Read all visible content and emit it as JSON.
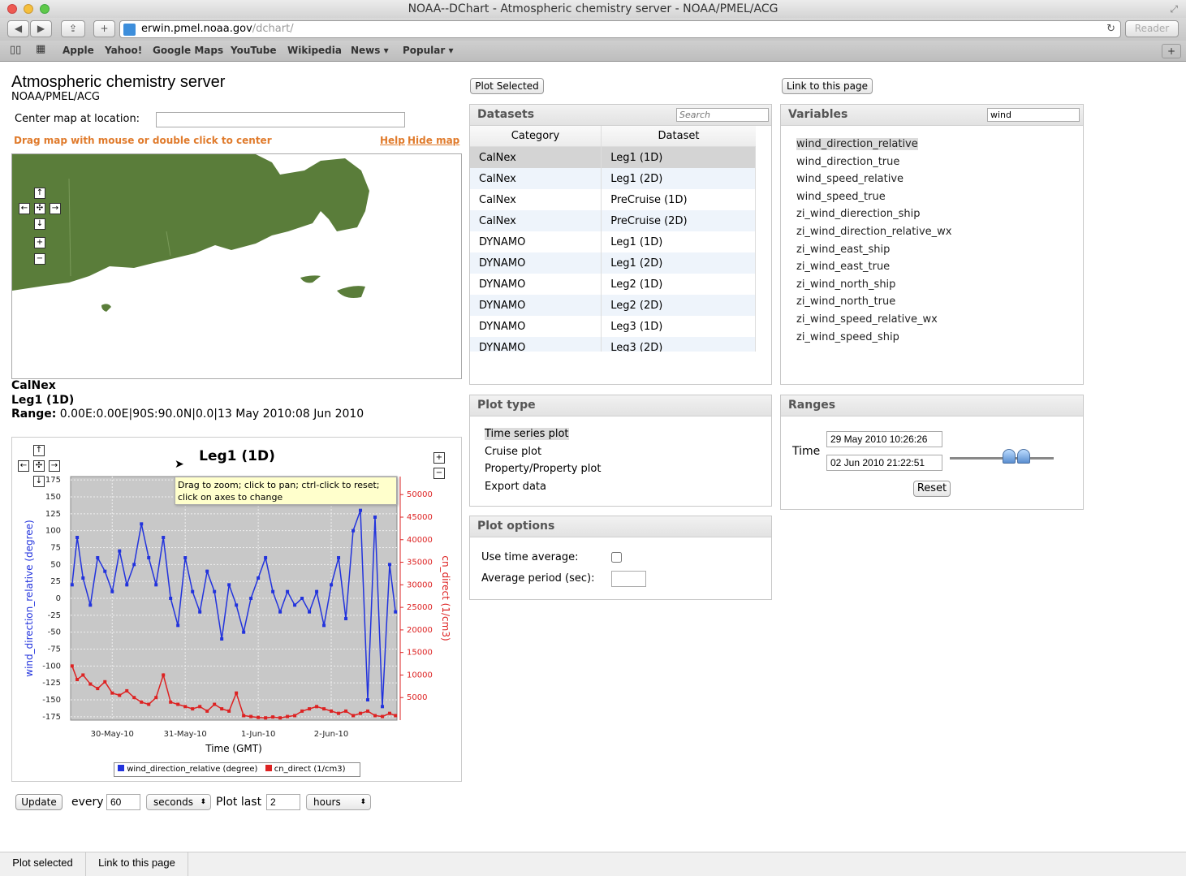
{
  "window": {
    "title": "NOAA--DChart - Atmospheric chemistry server - NOAA/PMEL/ACG"
  },
  "browser": {
    "url_host": "erwin.pmel.noaa.gov",
    "url_path": "/dchart/",
    "reader_label": "Reader",
    "bookmarks": [
      "Apple",
      "Yahoo!",
      "Google Maps",
      "YouTube",
      "Wikipedia",
      "News ▾",
      "Popular ▾"
    ]
  },
  "header": {
    "title": "Atmospheric chemistry server",
    "subtitle": "NOAA/PMEL/ACG"
  },
  "map": {
    "center_label": "Center map at location:",
    "center_value": "",
    "hint": "Drag map with mouse or double click to center",
    "help_link": "Help",
    "hide_link": "Hide map",
    "land_color": "#5a7d3a",
    "water_color": "#ffffff"
  },
  "selection": {
    "category": "CalNex",
    "dataset": "Leg1 (1D)",
    "range_label": "Range:",
    "range_value": "0.00E:0.00E|90S:90.0N|0.0|13 May 2010:08 Jun 2010"
  },
  "top_buttons": {
    "plot_selected": "Plot Selected",
    "link": "Link to this page"
  },
  "datasets": {
    "title": "Datasets",
    "search_placeholder": "Search",
    "columns": [
      "Category",
      "Dataset"
    ],
    "rows": [
      [
        "CalNex",
        "Leg1 (1D)"
      ],
      [
        "CalNex",
        "Leg1 (2D)"
      ],
      [
        "CalNex",
        "PreCruise (1D)"
      ],
      [
        "CalNex",
        "PreCruise (2D)"
      ],
      [
        "DYNAMO",
        "Leg1 (1D)"
      ],
      [
        "DYNAMO",
        "Leg1 (2D)"
      ],
      [
        "DYNAMO",
        "Leg2 (1D)"
      ],
      [
        "DYNAMO",
        "Leg2 (2D)"
      ],
      [
        "DYNAMO",
        "Leg3 (1D)"
      ],
      [
        "DYNAMO",
        "Leg3 (2D)"
      ]
    ]
  },
  "variables": {
    "title": "Variables",
    "search_value": "wind",
    "items": [
      "wind_direction_relative",
      "wind_direction_true",
      "wind_speed_relative",
      "wind_speed_true",
      "zi_wind_dierection_ship",
      "zi_wind_direction_relative_wx",
      "zi_wind_east_ship",
      "zi_wind_east_true",
      "zi_wind_north_ship",
      "zi_wind_north_true",
      "zi_wind_speed_relative_wx",
      "zi_wind_speed_ship"
    ]
  },
  "plot_type": {
    "title": "Plot type",
    "items": [
      "Time series plot",
      "Cruise plot",
      "Property/Property plot",
      "Export data"
    ]
  },
  "ranges": {
    "title": "Ranges",
    "time_label": "Time",
    "start": "29 May 2010 10:26:26",
    "end": "02 Jun 2010 21:22:51",
    "reset_label": "Reset"
  },
  "plot_options": {
    "title": "Plot options",
    "time_average_label": "Use time average:",
    "time_average_checked": false,
    "period_label": "Average period (sec):",
    "period_value": ""
  },
  "refresh": {
    "update_label": "Update",
    "every_label": "every",
    "every_value": "60",
    "unit_value": "seconds",
    "plot_last_label": "Plot last",
    "plot_last_value": "2",
    "plot_last_unit": "hours"
  },
  "tooltip": {
    "text_line1": "Drag to zoom; click to pan; ctrl-click to reset;",
    "text_line2": "click on axes to change"
  },
  "bottom_tabs": [
    "Plot selected",
    "Link to this page"
  ],
  "chart_data": {
    "type": "line",
    "title": "Leg1 (1D)",
    "xlabel": "Time (GMT)",
    "x_ticks": [
      "30-May-10",
      "31-May-10",
      "1-Jun-10",
      "2-Jun-10"
    ],
    "x_range_days": [
      29.43,
      33.9
    ],
    "y_left": {
      "label": "wind_direction_relative (degree)",
      "ticks": [
        -175,
        -150,
        -125,
        -100,
        -75,
        -50,
        -25,
        0,
        25,
        50,
        75,
        100,
        125,
        150,
        175
      ],
      "lim": [
        -180,
        180
      ],
      "color": "#2233dd"
    },
    "y_right": {
      "label": "cn_direct (1/cm3)",
      "ticks": [
        5000,
        10000,
        15000,
        20000,
        25000,
        30000,
        35000,
        40000,
        45000,
        50000
      ],
      "lim": [
        0,
        54000
      ],
      "color": "#dd2222"
    },
    "grid": true,
    "legend_position": "bottom",
    "series": [
      {
        "name": "wind_direction_relative (degree)",
        "axis": "left",
        "color": "#2233dd",
        "x": [
          29.45,
          29.52,
          29.6,
          29.7,
          29.8,
          29.9,
          30.0,
          30.1,
          30.2,
          30.3,
          30.4,
          30.5,
          30.6,
          30.7,
          30.8,
          30.9,
          31.0,
          31.1,
          31.2,
          31.3,
          31.4,
          31.5,
          31.6,
          31.7,
          31.8,
          31.9,
          32.0,
          32.1,
          32.2,
          32.3,
          32.4,
          32.5,
          32.6,
          32.7,
          32.8,
          32.9,
          33.0,
          33.1,
          33.2,
          33.3,
          33.4,
          33.5,
          33.6,
          33.7,
          33.8,
          33.88
        ],
        "y": [
          20,
          90,
          30,
          -10,
          60,
          40,
          10,
          70,
          20,
          50,
          110,
          60,
          20,
          90,
          0,
          -40,
          60,
          10,
          -20,
          40,
          10,
          -60,
          20,
          -10,
          -50,
          0,
          30,
          60,
          10,
          -20,
          10,
          -10,
          0,
          -20,
          10,
          -40,
          20,
          60,
          -30,
          100,
          130,
          -150,
          120,
          -160,
          50,
          -20
        ]
      },
      {
        "name": "cn_direct (1/cm3)",
        "axis": "right",
        "color": "#dd2222",
        "x": [
          29.45,
          29.52,
          29.6,
          29.7,
          29.8,
          29.9,
          30.0,
          30.1,
          30.2,
          30.3,
          30.4,
          30.5,
          30.6,
          30.7,
          30.8,
          30.9,
          31.0,
          31.1,
          31.2,
          31.3,
          31.4,
          31.5,
          31.6,
          31.7,
          31.8,
          31.9,
          32.0,
          32.1,
          32.2,
          32.3,
          32.4,
          32.5,
          32.6,
          32.7,
          32.8,
          32.9,
          33.0,
          33.1,
          33.2,
          33.3,
          33.4,
          33.5,
          33.6,
          33.7,
          33.8,
          33.88
        ],
        "y": [
          12000,
          9000,
          10000,
          8000,
          7000,
          8500,
          6000,
          5500,
          6500,
          5000,
          4000,
          3500,
          5000,
          10000,
          4000,
          3500,
          3000,
          2500,
          3000,
          2000,
          3500,
          2500,
          2000,
          6000,
          1000,
          800,
          600,
          500,
          700,
          500,
          800,
          1000,
          2000,
          2500,
          3000,
          2500,
          2000,
          1500,
          2000,
          1000,
          1500,
          2000,
          1000,
          800,
          1500,
          1000
        ]
      }
    ]
  }
}
